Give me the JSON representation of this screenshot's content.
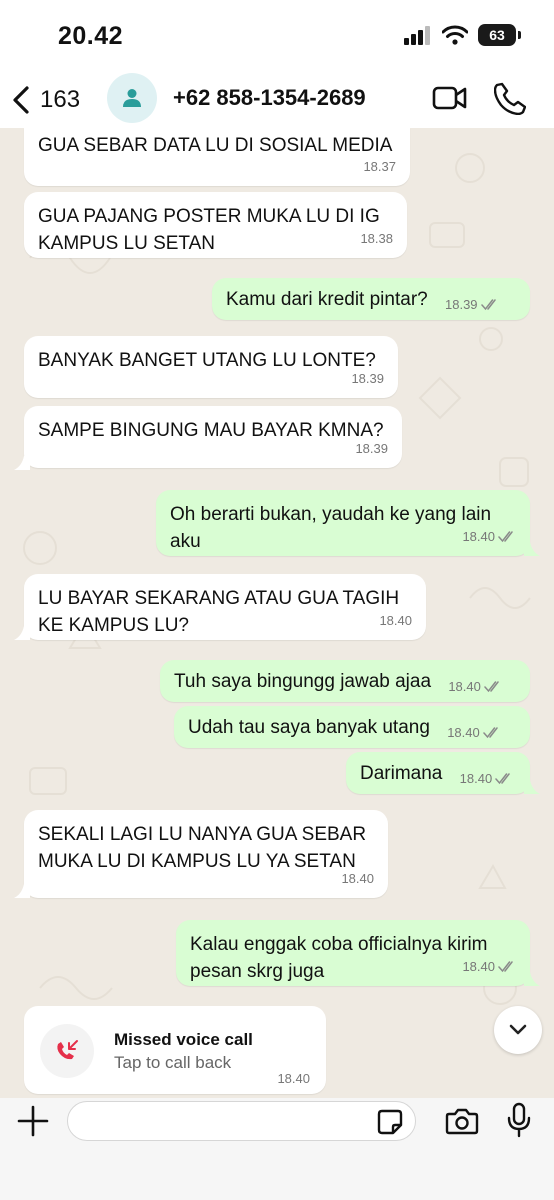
{
  "status_bar": {
    "time": "20.42",
    "battery": "63"
  },
  "header": {
    "back_count": "163",
    "contact": "+62 858-1354-2689"
  },
  "messages": [
    {
      "dir": "in",
      "text": "GUA SEBAR DATA LU DI SOSIAL MEDIA",
      "time": "18.37"
    },
    {
      "dir": "in",
      "text": "GUA PAJANG POSTER MUKA LU DI IG\nKAMPUS LU SETAN",
      "time": "18.38"
    },
    {
      "dir": "out",
      "text": "Kamu dari kredit pintar?",
      "time": "18.39"
    },
    {
      "dir": "in",
      "text": "BANYAK BANGET UTANG LU LONTE?",
      "time": "18.39"
    },
    {
      "dir": "in",
      "text": "SAMPE BINGUNG MAU BAYAR KMNA?",
      "time": "18.39"
    },
    {
      "dir": "out",
      "text": "Oh berarti bukan, yaudah ke yang lain\naku",
      "time": "18.40"
    },
    {
      "dir": "in",
      "text": "LU BAYAR SEKARANG ATAU GUA TAGIH\nKE KAMPUS LU?",
      "time": "18.40"
    },
    {
      "dir": "out",
      "text": "Tuh saya bingungg jawab ajaa",
      "time": "18.40"
    },
    {
      "dir": "out",
      "text": "Udah tau saya banyak utang",
      "time": "18.40"
    },
    {
      "dir": "out",
      "text": "Darimana",
      "time": "18.40"
    },
    {
      "dir": "in",
      "text": "SEKALI LAGI LU NANYA GUA SEBAR\nMUKA LU DI KAMPUS LU YA SETAN",
      "time": "18.40"
    },
    {
      "dir": "out",
      "text": "Kalau enggak coba officialnya kirim\npesan skrg juga",
      "time": "18.40"
    }
  ],
  "missed_call": {
    "title": "Missed voice call",
    "subtitle": "Tap to call back",
    "time": "18.40"
  },
  "input": {
    "placeholder": ""
  },
  "colors": {
    "incoming": "#ffffff",
    "outgoing": "#d9fdd3",
    "background": "#efeae2",
    "missed_call_red": "#e5304a",
    "avatar_teal": "#2a9d9a"
  },
  "icons": [
    "chevron-left-icon",
    "person-icon",
    "video-camera-icon",
    "phone-icon",
    "double-check-icon",
    "missed-call-icon",
    "chevron-down-icon",
    "plus-icon",
    "sticker-icon",
    "camera-icon",
    "microphone-icon",
    "signal-icon",
    "wifi-icon",
    "battery-icon"
  ]
}
